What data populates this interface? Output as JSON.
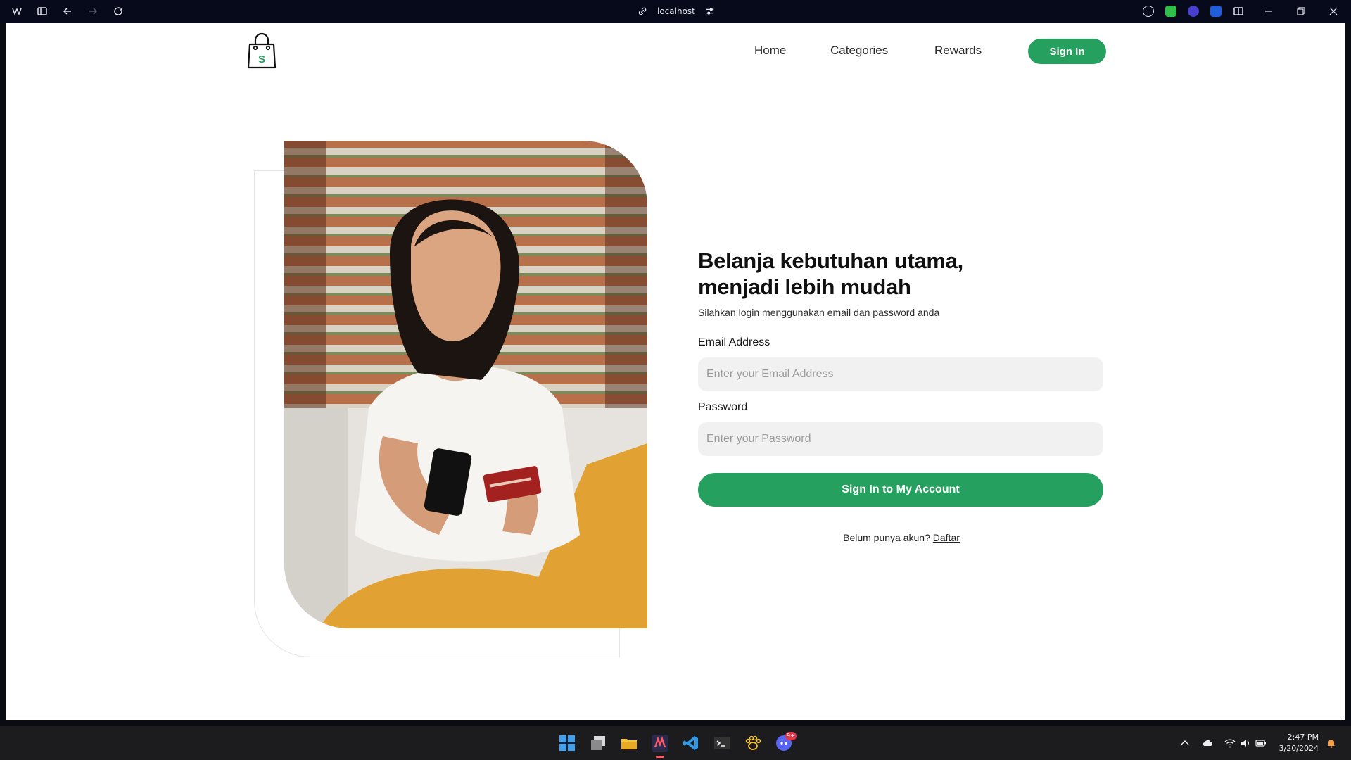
{
  "browser": {
    "url": "localhost"
  },
  "nav": {
    "logo_letter": "S",
    "links": [
      "Home",
      "Categories",
      "Rewards"
    ],
    "signin_label": "Sign In"
  },
  "hero": {
    "title_line1": "Belanja kebutuhan utama,",
    "title_line2": "menjadi lebih mudah",
    "subtitle": "Silahkan login menggunakan email dan password anda"
  },
  "form": {
    "email_label": "Email Address",
    "email_placeholder": "Enter your Email Address",
    "password_label": "Password",
    "password_placeholder": "Enter your Password",
    "submit_label": "Sign In to My Account",
    "signup_prompt": "Belum punya akun?",
    "signup_link": "Daftar"
  },
  "taskbar": {
    "time": "2:47 PM",
    "date": "3/20/2024",
    "discord_badge": "9+"
  },
  "colors": {
    "accent": "#26a05e",
    "browser_bar": "#070a1a",
    "taskbar": "#1c1c1f"
  }
}
